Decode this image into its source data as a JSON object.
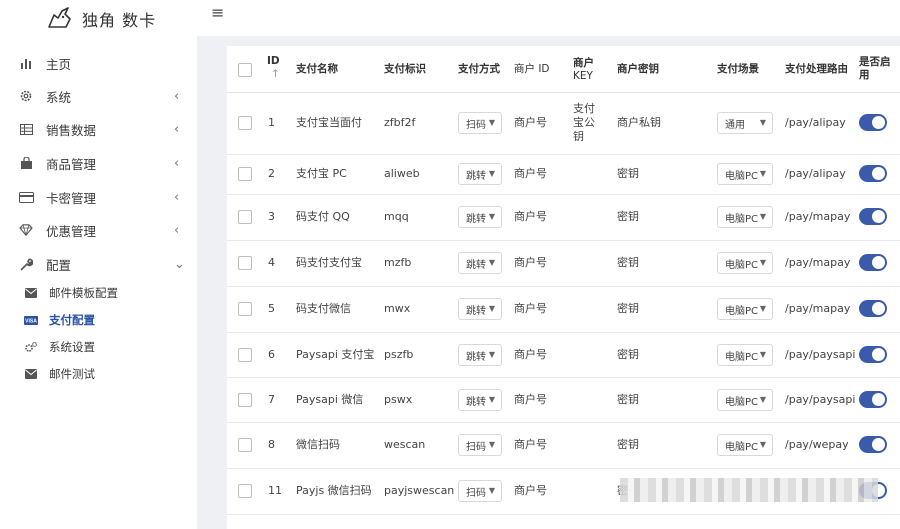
{
  "brand": {
    "title": "独角 数卡"
  },
  "sidebar": {
    "items": [
      {
        "label": "主页",
        "icon": "bar-chart-icon",
        "has_arrow": false
      },
      {
        "label": "系统",
        "icon": "gear-icon",
        "has_arrow": true
      },
      {
        "label": "销售数据",
        "icon": "table-icon",
        "has_arrow": true
      },
      {
        "label": "商品管理",
        "icon": "shopping-bag-icon",
        "has_arrow": true
      },
      {
        "label": "卡密管理",
        "icon": "credit-card-icon",
        "has_arrow": true
      },
      {
        "label": "优惠管理",
        "icon": "diamond-icon",
        "has_arrow": true
      },
      {
        "label": "配置",
        "icon": "wrench-icon",
        "has_arrow": true,
        "expanded": true
      }
    ],
    "sub_items": [
      {
        "label": "邮件模板配置",
        "icon": "envelope-icon",
        "active": false
      },
      {
        "label": "支付配置",
        "icon": "visa-card-icon",
        "active": true
      },
      {
        "label": "系统设置",
        "icon": "cogs-icon",
        "active": false
      },
      {
        "label": "邮件测试",
        "icon": "envelope-icon",
        "active": false
      }
    ],
    "arrow_collapsed": "‹",
    "arrow_expanded": "⌄"
  },
  "topbar": {
    "menu_icon": "≡"
  },
  "table": {
    "headers": {
      "id": "ID",
      "id_sort": "↑",
      "name": "支付名称",
      "code": "支付标识",
      "method": "支付方式",
      "merchant_id": "商户 ID",
      "merchant_key_1": "商户",
      "merchant_key_2": "KEY",
      "merchant_secret": "商户密钥",
      "scene": "支付场景",
      "route": "支付处理路由",
      "enabled_1": "是否启",
      "enabled_2": "用"
    },
    "rows": [
      {
        "id": "1",
        "name": "支付宝当面付",
        "code": "zfbf2f",
        "method": "扫码",
        "merchant_id": "商户号",
        "key_lines": [
          "支付",
          "宝公",
          "钥"
        ],
        "secret": "商户私钥",
        "scene": "通用",
        "route": "/pay/alipay",
        "enabled": true
      },
      {
        "id": "2",
        "name": "支付宝 PC",
        "code": "aliweb",
        "method": "跳转",
        "merchant_id": "商户号",
        "key_lines": [],
        "secret": "密钥",
        "scene": "电脑PC",
        "route": "/pay/alipay",
        "enabled": true
      },
      {
        "id": "3",
        "name": "码支付 QQ",
        "code": "mqq",
        "method": "跳转",
        "merchant_id": "商户号",
        "key_lines": [],
        "secret": "密钥",
        "scene": "电脑PC",
        "route": "/pay/mapay",
        "enabled": true
      },
      {
        "id": "4",
        "name": "码支付支付宝",
        "code": "mzfb",
        "method": "跳转",
        "merchant_id": "商户号",
        "key_lines": [],
        "secret": "密钥",
        "scene": "电脑PC",
        "route": "/pay/mapay",
        "enabled": true
      },
      {
        "id": "5",
        "name": "码支付微信",
        "code": "mwx",
        "method": "跳转",
        "merchant_id": "商户号",
        "key_lines": [],
        "secret": "密钥",
        "scene": "电脑PC",
        "route": "/pay/mapay",
        "enabled": true
      },
      {
        "id": "6",
        "name": "Paysapi 支付宝",
        "code": "pszfb",
        "method": "跳转",
        "merchant_id": "商户号",
        "key_lines": [],
        "secret": "密钥",
        "scene": "电脑PC",
        "route": "/pay/paysapi",
        "enabled": true
      },
      {
        "id": "7",
        "name": "Paysapi 微信",
        "code": "pswx",
        "method": "跳转",
        "merchant_id": "商户号",
        "key_lines": [],
        "secret": "密钥",
        "scene": "电脑PC",
        "route": "/pay/paysapi",
        "enabled": true
      },
      {
        "id": "8",
        "name": "微信扫码",
        "code": "wescan",
        "method": "扫码",
        "merchant_id": "商户号",
        "key_lines": [],
        "secret": "密钥",
        "scene": "电脑PC",
        "route": "/pay/wepay",
        "enabled": true
      },
      {
        "id": "11",
        "name": "Payjs 微信扫码",
        "code": "payjswescan",
        "method": "扫码",
        "merchant_id": "商户号",
        "key_lines": [],
        "secret": "密",
        "scene": "",
        "route": "",
        "enabled": true
      }
    ],
    "caret": "▼"
  },
  "colors": {
    "accent": "#3b5aa9",
    "active_nav": "#2a54a8",
    "content_bg": "#eef0f3"
  }
}
